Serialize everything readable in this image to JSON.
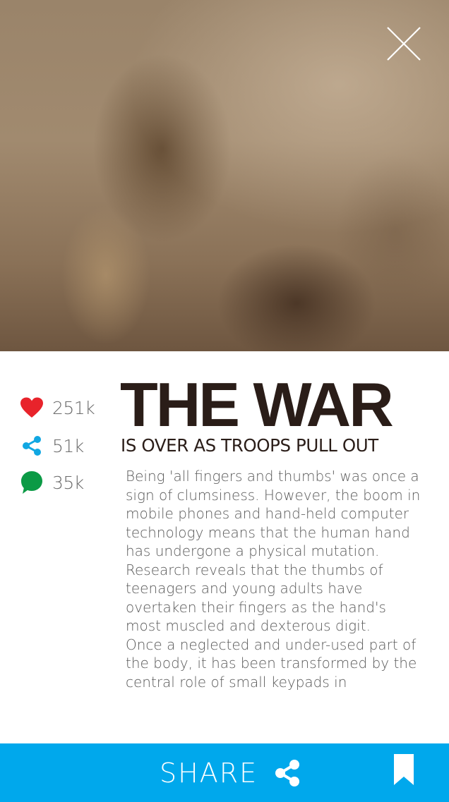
{
  "hero": {
    "image_alt": "Soldiers crouching in a dust storm"
  },
  "header": {
    "close_icon": "close-icon"
  },
  "stats": [
    {
      "icon": "heart-icon",
      "color": "#e8232b",
      "count": "251k"
    },
    {
      "icon": "share-icon",
      "color": "#11a7e2",
      "count": "51k"
    },
    {
      "icon": "comment-icon",
      "color": "#0b9a45",
      "count": "35k"
    }
  ],
  "article": {
    "title": "THE WAR",
    "subtitle": "IS OVER AS TROOPS PULL OUT",
    "paragraphs": [
      "Being 'all fingers and thumbs' was once a sign of clumsiness. However, the boom in mobile phones and hand-held computer technology means that the human hand has undergone a physical mutation.",
      "Research reveals that the thumbs of teenagers and young adults have overtaken their fingers as the hand's most muscled and dexterous digit.",
      "Once a neglected and under-used part of the body, it has been transformed by the central role of small keypads in"
    ]
  },
  "footer": {
    "share_label": "SHARE",
    "share_icon": "share-icon",
    "bookmark_icon": "bookmark-icon",
    "bar_color": "#00a8ec"
  }
}
